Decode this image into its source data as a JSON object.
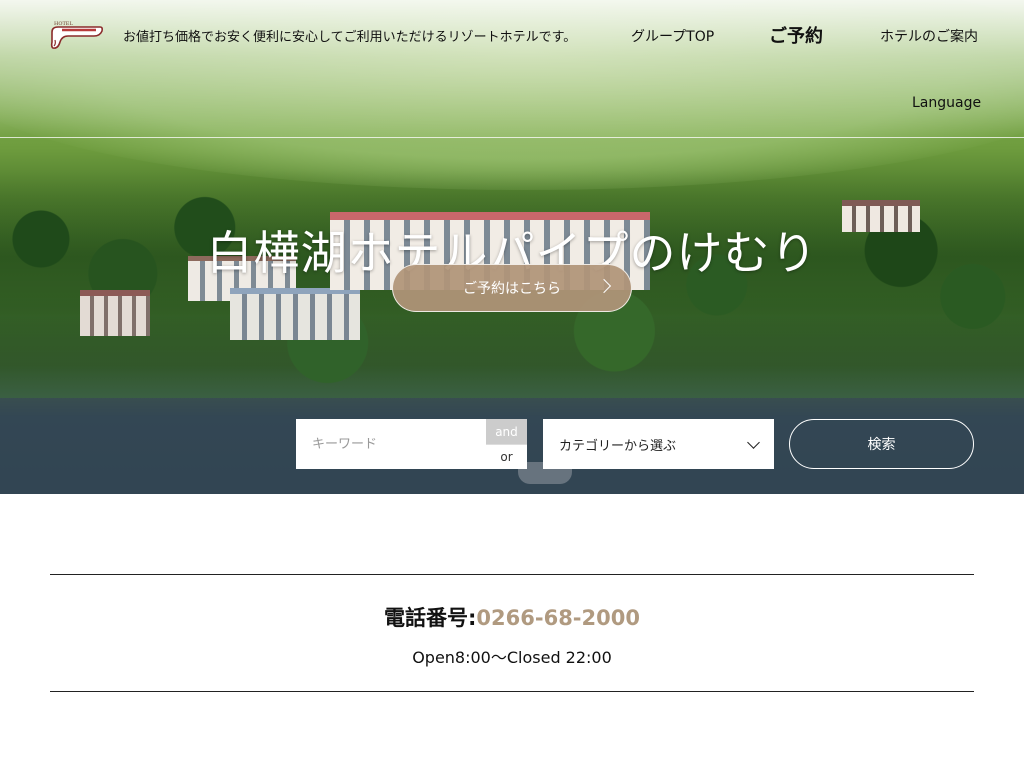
{
  "header": {
    "logo_alt": "HOTEL パイプのけむり",
    "tagline": "お値打ち価格でお安く便利に安心してご利用いただけるリゾートホテルです。",
    "nav": {
      "group_top": "グループTOP",
      "reserve": "ご予約",
      "hotel_guide": "ホテルのご案内",
      "language": "Language"
    }
  },
  "hero": {
    "title": "白樺湖ホテルパイプのけむり",
    "reserve_button": "ご予約はこちら"
  },
  "search": {
    "keyword_placeholder": "キーワード",
    "keyword_value": "",
    "mode_and": "and",
    "mode_or": "or",
    "category_selected": "カテゴリーから選ぶ",
    "search_button": "検索"
  },
  "contact": {
    "phone_label": "電話番号:",
    "phone_number": "0266-68-2000",
    "hours": "Open8:00〜Closed 22:00"
  },
  "colors": {
    "accent": "#b09a80",
    "reserve_button_bg": "#b09478",
    "and_toggle_active": "#cccccc"
  }
}
